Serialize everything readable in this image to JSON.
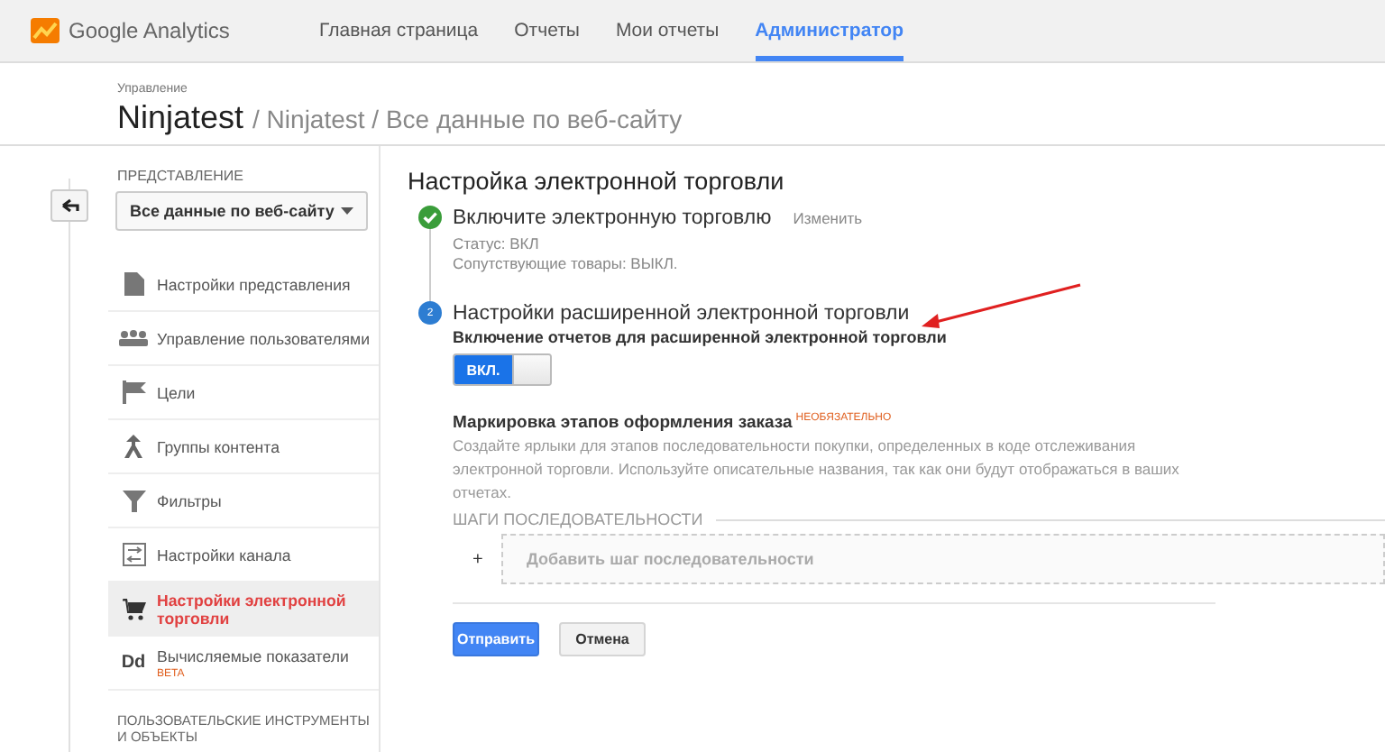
{
  "app": {
    "name": "Google Analytics"
  },
  "nav": [
    {
      "label": "Главная страница",
      "selected": false
    },
    {
      "label": "Отчеты",
      "selected": false
    },
    {
      "label": "Мои отчеты",
      "selected": false
    },
    {
      "label": "Администратор",
      "selected": true
    }
  ],
  "breadcrumb": {
    "caption": "Управление",
    "account": "Ninjatest",
    "path": "/ Ninjatest / Все данные по веб-сайту"
  },
  "sidebar": {
    "section_label": "ПРЕДСТАВЛЕНИЕ",
    "view_select": "Все данные по веб-сайту",
    "items": [
      {
        "label": "Настройки представления",
        "selected": false
      },
      {
        "label": "Управление пользователями",
        "selected": false
      },
      {
        "label": "Цели",
        "selected": false
      },
      {
        "label": "Группы контента",
        "selected": false
      },
      {
        "label": "Фильтры",
        "selected": false
      },
      {
        "label": "Настройки канала",
        "selected": false
      },
      {
        "label": "Настройки электронной торговли",
        "selected": true
      },
      {
        "label": "Вычисляемые показатели",
        "selected": false,
        "badge": "BETA",
        "icon_text": "Dd"
      }
    ],
    "footer_label": "ПОЛЬЗОВАТЕЛЬСКИЕ ИНСТРУМЕНТЫ И ОБЪЕКТЫ"
  },
  "main": {
    "title": "Настройка электронной торговли",
    "steps": [
      {
        "kind": "done",
        "title": "Включите электронную торговлю",
        "action": "Изменить",
        "lines": [
          "Статус: ВКЛ",
          "Сопутствующие товары: ВЫКЛ."
        ]
      },
      {
        "kind": "current",
        "number": "2",
        "title": "Настройки расширенной электронной торговли"
      }
    ],
    "toggle": {
      "label": "Включение отчетов для расширенной электронной торговли",
      "text": "ВКЛ.",
      "on": true
    },
    "funnel": {
      "title": "Маркировка этапов оформления заказа",
      "tag": "НЕОБЯЗАТЕЛЬНО",
      "description": "Создайте ярлыки для этапов последовательности покупки, определенных в коде отслеживания электронной торговли. Используйте описательные названия, так как они будут отображаться в ваших отчетах.",
      "steps_label": "ШАГИ ПОСЛЕДОВАТЕЛЬНОСТИ",
      "add_plus": "+",
      "add_placeholder": "Добавить шаг последовательности"
    },
    "buttons": [
      {
        "kind": "primary",
        "label": "Отправить"
      },
      {
        "kind": "secondary",
        "label": "Отмена"
      }
    ]
  }
}
